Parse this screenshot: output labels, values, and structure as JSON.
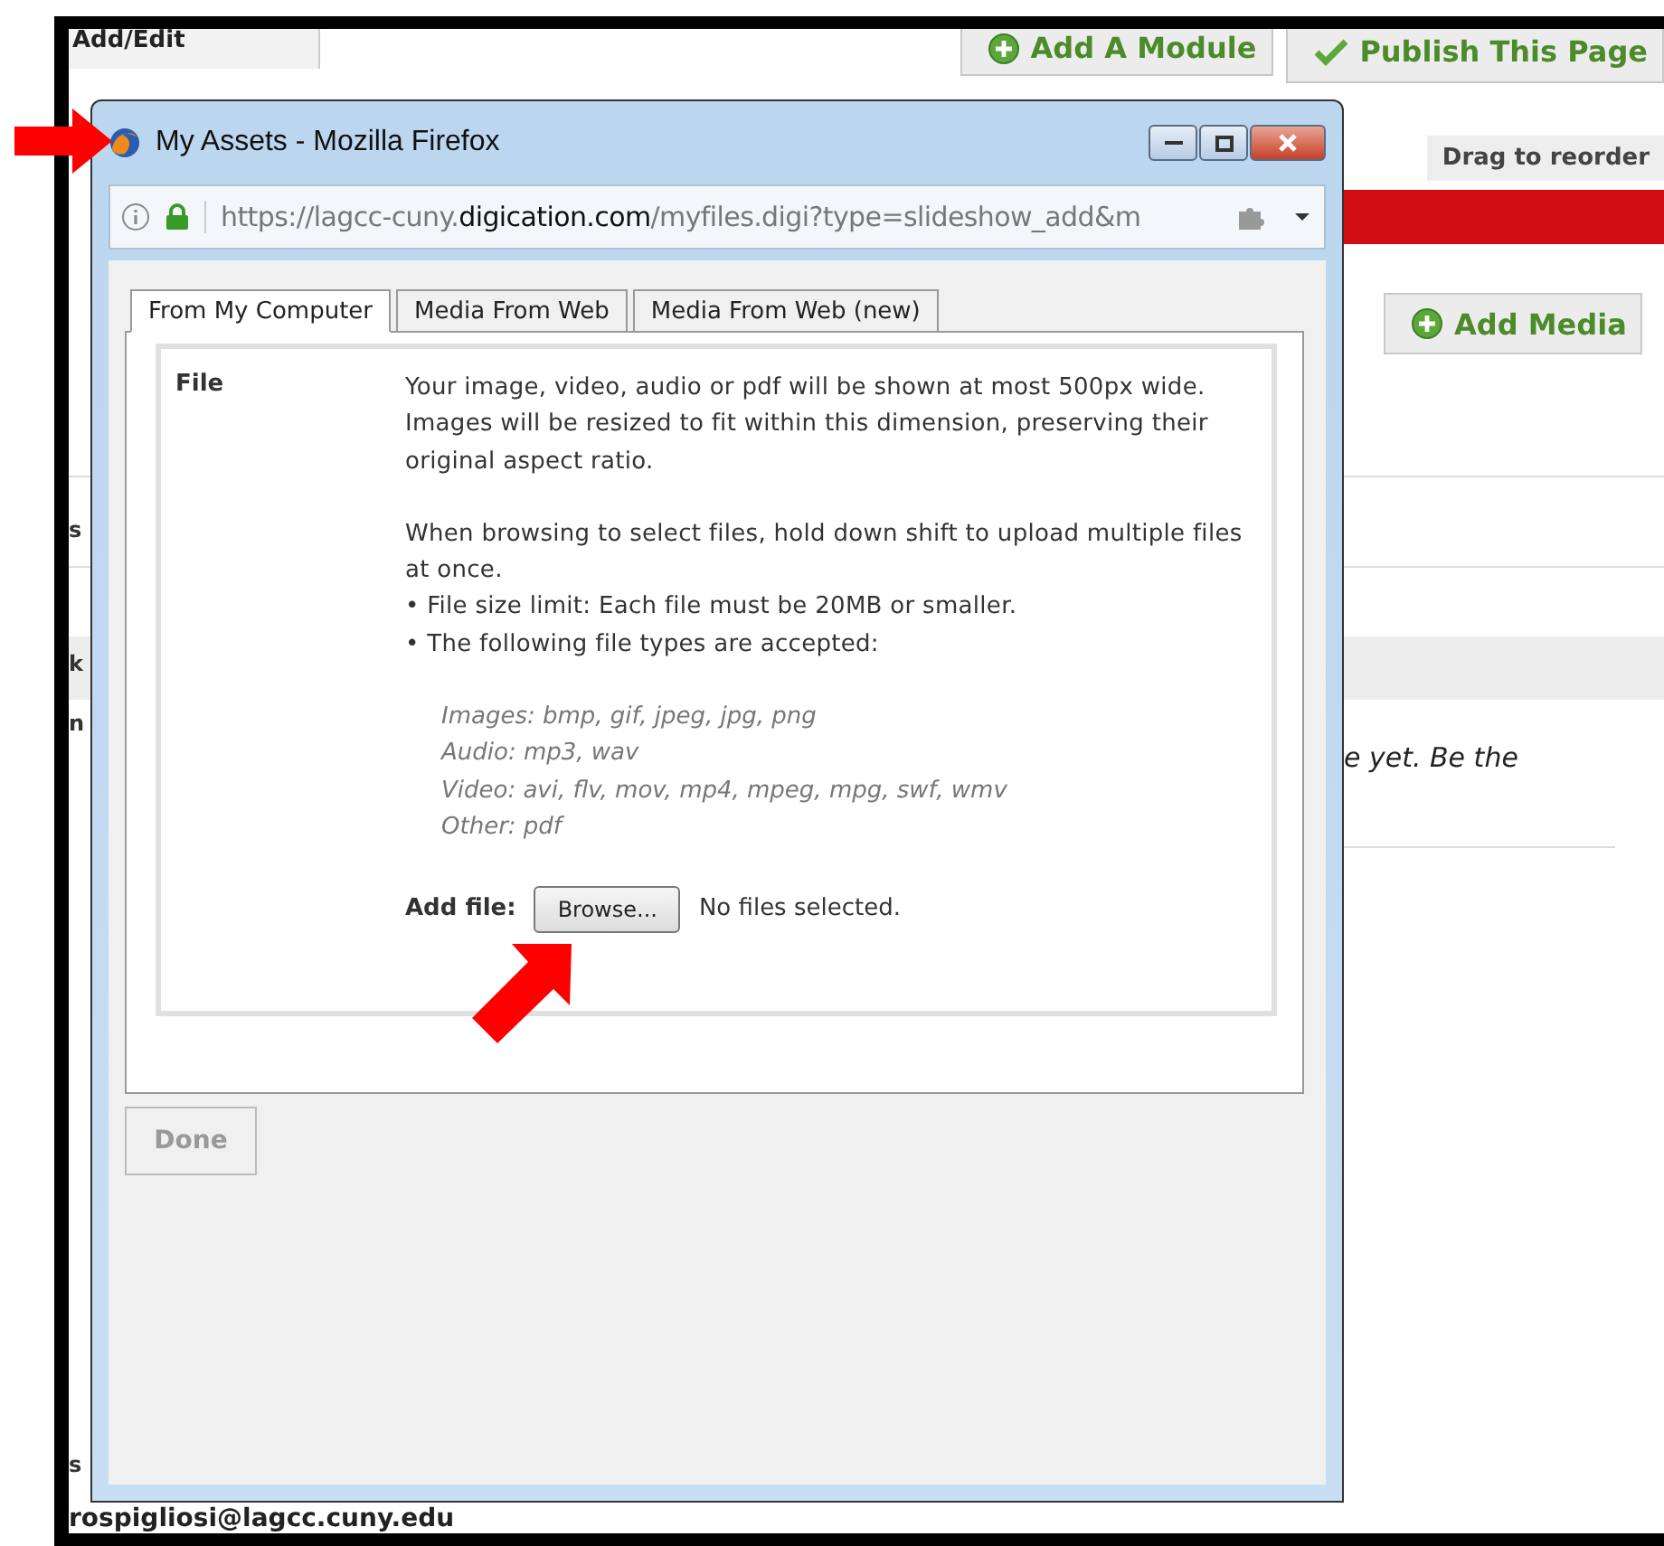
{
  "page": {
    "edit_tab": "Add/Edit",
    "header_buttons": [
      {
        "kind": "add",
        "label": "Add A Module"
      },
      {
        "kind": "publish",
        "label": "Publish This Page"
      }
    ],
    "drag_label": "Drag to reorder",
    "add_media": "Add Media",
    "left_fragments": [
      "s",
      "k",
      "n",
      "s"
    ],
    "comment_fragment": "e yet. Be the",
    "email": "rospigliosi@lagcc.cuny.edu"
  },
  "window": {
    "title": "My Assets - Mozilla Firefox",
    "address": "https://lagcc-cuny.**digication.com**/myfiles.digi?type=slideshow_add&m",
    "tabs": [
      {
        "label": "From My Computer",
        "selected": true
      },
      {
        "label": "Media From Web",
        "selected": false
      },
      {
        "label": "Media From Web (new)",
        "selected": false
      }
    ],
    "field_label": "File",
    "paragraphs": [
      "Your image, video, audio or pdf will be shown at most 500px wide. Images will be resized to fit within this dimension, preserving their original aspect ratio.",
      "When browsing to select files, hold down shift to upload multiple files at once."
    ],
    "bullets": [
      "• File size limit: Each file must be 20MB or smaller.",
      "• The following file types are accepted:"
    ],
    "file_types": [
      "Images: bmp, gif, jpeg, jpg, png",
      "Audio: mp3, wav",
      "Video: avi, flv, mov, mp4, mpeg, mpg, swf, wmv",
      "Other: pdf"
    ],
    "add_file_label": "Add file:",
    "browse_button": "Browse...",
    "file_status": "No files selected.",
    "done_button": {
      "label": "Done",
      "disabled": true
    }
  }
}
